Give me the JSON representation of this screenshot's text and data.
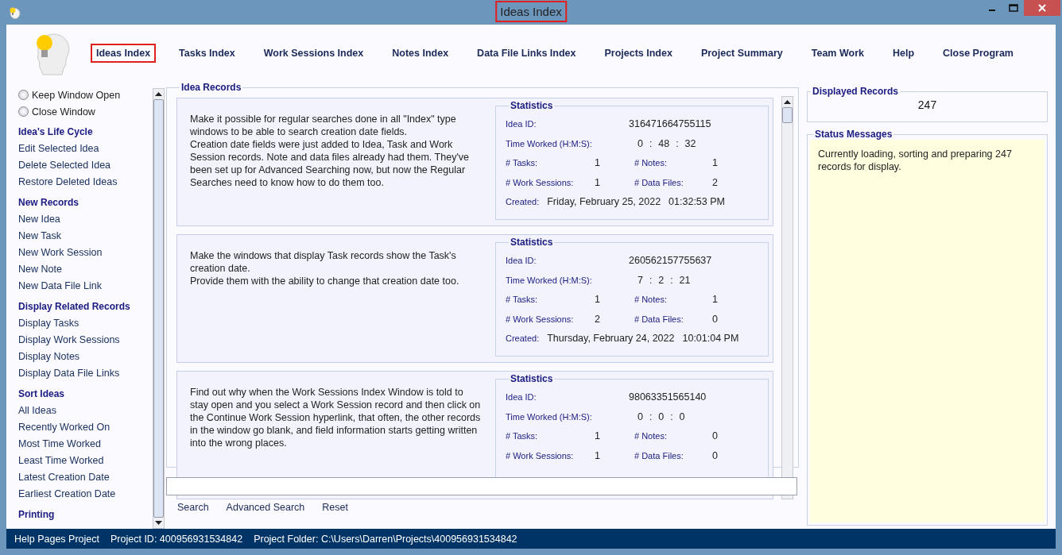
{
  "window": {
    "title": "Ideas Index",
    "title_highlighted": true
  },
  "nav": [
    {
      "label": "Ideas Index",
      "selected": true
    },
    {
      "label": "Tasks Index",
      "selected": false
    },
    {
      "label": "Work Sessions Index",
      "selected": false
    },
    {
      "label": "Notes Index",
      "selected": false
    },
    {
      "label": "Data File Links Index",
      "selected": false
    },
    {
      "label": "Projects Index",
      "selected": false
    },
    {
      "label": "Project Summary",
      "selected": false
    },
    {
      "label": "Team Work",
      "selected": false
    },
    {
      "label": "Help",
      "selected": false
    },
    {
      "label": "Close Program",
      "selected": false
    }
  ],
  "sidebar": [
    {
      "kind": "radio",
      "label": "Keep Window Open",
      "checked": false
    },
    {
      "kind": "radio",
      "label": "Close Window",
      "checked": false
    },
    {
      "kind": "heading",
      "label": "Idea's Life Cycle"
    },
    {
      "kind": "link",
      "label": "Edit Selected Idea"
    },
    {
      "kind": "link",
      "label": "Delete Selected Idea"
    },
    {
      "kind": "link",
      "label": "Restore Deleted Ideas"
    },
    {
      "kind": "heading",
      "label": "New Records"
    },
    {
      "kind": "link",
      "label": "New Idea"
    },
    {
      "kind": "link",
      "label": "New Task"
    },
    {
      "kind": "link",
      "label": "New Work Session"
    },
    {
      "kind": "link",
      "label": "New Note"
    },
    {
      "kind": "link",
      "label": "New Data File Link"
    },
    {
      "kind": "heading",
      "label": "Display Related Records"
    },
    {
      "kind": "link",
      "label": "Display Tasks"
    },
    {
      "kind": "link",
      "label": "Display Work Sessions"
    },
    {
      "kind": "link",
      "label": "Display Notes"
    },
    {
      "kind": "link",
      "label": "Display Data File Links"
    },
    {
      "kind": "heading",
      "label": "Sort Ideas"
    },
    {
      "kind": "link",
      "label": "All Ideas"
    },
    {
      "kind": "link",
      "label": "Recently Worked On"
    },
    {
      "kind": "link",
      "label": "Most Time Worked"
    },
    {
      "kind": "link",
      "label": "Least Time Worked"
    },
    {
      "kind": "link",
      "label": "Latest Creation Date"
    },
    {
      "kind": "link",
      "label": "Earliest Creation Date"
    },
    {
      "kind": "heading",
      "label": "Printing"
    }
  ],
  "records": {
    "title": "Idea Records",
    "items": [
      {
        "text": "Make it possible for regular searches done in all \"Index\" type windows to be able to search creation date fields.\nCreation date fields were just added to Idea, Task and Work Session records. Note and data files already had them. They've been set up for Advanced Searching now, but now the Regular Searches need to know how to do them too.",
        "stats_title": "Statistics",
        "id_label": "Idea ID:",
        "id": "316471664755115",
        "time_label": "Time Worked (H:M:S):",
        "time": [
          "0",
          ":",
          "48",
          ":",
          "32"
        ],
        "tasks_label": "# Tasks:",
        "tasks": "1",
        "notes_label": "# Notes:",
        "notes": "1",
        "sessions_label": "# Work Sessions:",
        "sessions": "1",
        "files_label": "# Data Files:",
        "files": "2",
        "created_label": "Created:",
        "created_date": "Friday, February 25, 2022",
        "created_time": "01:32:53 PM"
      },
      {
        "text": "Make the windows that display Task records show the Task's creation date.\nProvide them with the ability to change that creation date too.",
        "stats_title": "Statistics",
        "id_label": "Idea ID:",
        "id": "260562157755637",
        "time_label": "Time Worked (H:M:S):",
        "time": [
          "7",
          ":",
          "2",
          ":",
          "21"
        ],
        "tasks_label": "# Tasks:",
        "tasks": "1",
        "notes_label": "# Notes:",
        "notes": "1",
        "sessions_label": "# Work Sessions:",
        "sessions": "2",
        "files_label": "# Data Files:",
        "files": "0",
        "created_label": "Created:",
        "created_date": "Thursday, February 24, 2022",
        "created_time": "10:01:04 PM"
      },
      {
        "text": "Find out why when the Work Sessions Index Window is told to stay open and you select a Work Session record and then click on the Continue Work Session hyperlink, that often, the other records in the window go blank, and field information starts getting written into the wrong places.",
        "stats_title": "Statistics",
        "id_label": "Idea ID:",
        "id": "98063351565140",
        "time_label": "Time Worked (H:M:S):",
        "time": [
          "0",
          ":",
          "0",
          ":",
          "0"
        ],
        "tasks_label": "# Tasks:",
        "tasks": "1",
        "notes_label": "# Notes:",
        "notes": "0",
        "sessions_label": "# Work Sessions:",
        "sessions": "1",
        "files_label": "# Data Files:",
        "files": "0"
      }
    ]
  },
  "search": {
    "buttons": [
      "Search",
      "Advanced Search",
      "Reset"
    ]
  },
  "displayed": {
    "title": "Displayed Records",
    "value": "247"
  },
  "status_messages": {
    "title": "Status Messages",
    "text": "Currently loading, sorting and preparing 247 records for display."
  },
  "status_bar": [
    "Help Pages Project",
    "Project ID:  400956931534842",
    "Project Folder: C:\\Users\\Darren\\Projects\\400956931534842"
  ]
}
